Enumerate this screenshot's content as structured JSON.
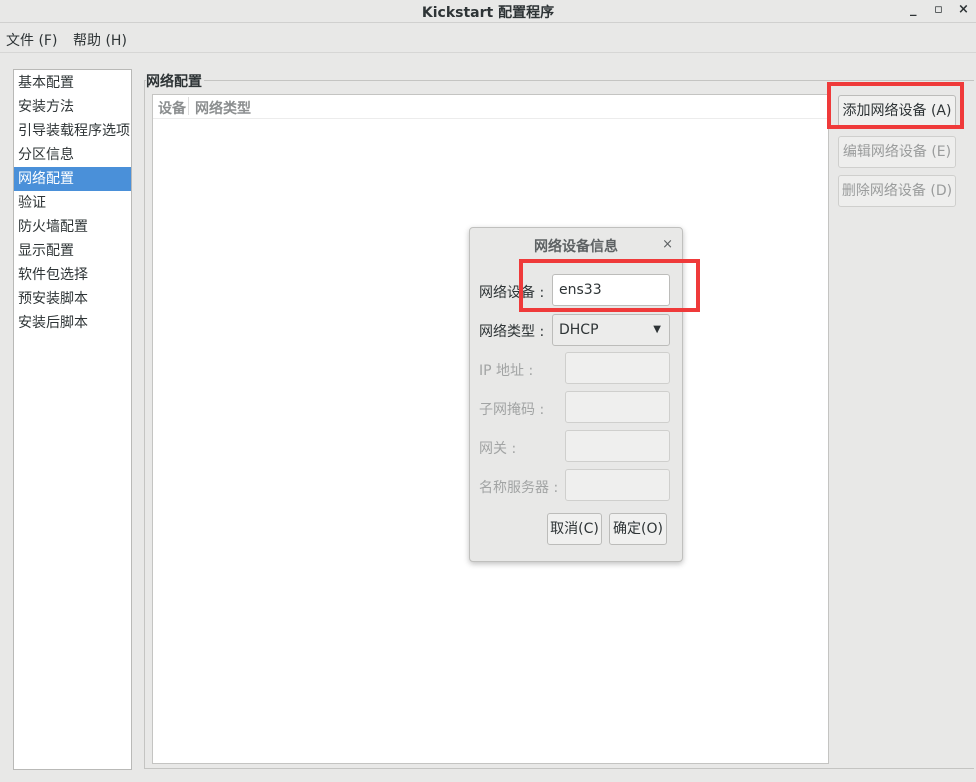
{
  "window": {
    "title": "Kickstart 配置程序",
    "minimize": "_",
    "maximize": "▫",
    "close": "×"
  },
  "menu": {
    "file": "文件 (F)",
    "help": "帮助 (H)"
  },
  "sidebar": {
    "items": [
      "基本配置",
      "安装方法",
      "引导装载程序选项",
      "分区信息",
      "网络配置",
      "验证",
      "防火墙配置",
      "显示配置",
      "软件包选择",
      "预安装脚本",
      "安装后脚本"
    ],
    "selected": "网络配置"
  },
  "network": {
    "section_title": "网络配置",
    "columns": [
      "设备",
      "网络类型"
    ],
    "add_button": "添加网络设备 (A)",
    "edit_button": "编辑网络设备 (E)",
    "delete_button": "删除网络设备 (D)"
  },
  "dialog": {
    "title": "网络设备信息",
    "close": "×",
    "device_label": "网络设备 :",
    "device_value": "ens33",
    "type_label": "网络类型 :",
    "type_value": "DHCP",
    "ip_label": "IP 地址 :",
    "netmask_label": "子网掩码 :",
    "gateway_label": "网关 :",
    "dns_label": "名称服务器 :",
    "cancel": "取消(C)",
    "ok": "确定(O)"
  },
  "colors": {
    "highlight": "#ef3a3a",
    "selection": "#4a90d9"
  }
}
